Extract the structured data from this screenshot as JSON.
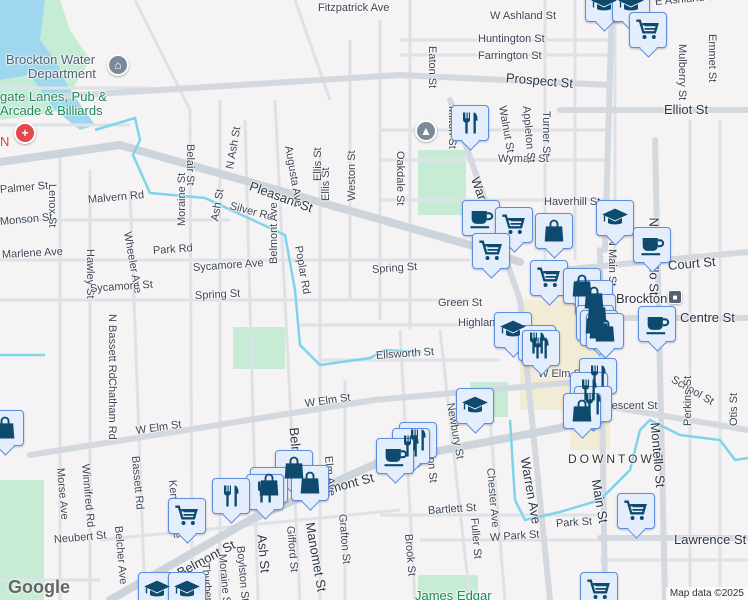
{
  "map": {
    "attribution": "Map data ©2025",
    "logo": "Google",
    "colors": {
      "marker_bg": "#e4edfc",
      "marker_border": "#5c8ee0",
      "marker_icon": "#0d4a6e",
      "water": "#9fd8ee",
      "stream": "#7fd4ea",
      "park": "#c6ecd5",
      "road": "#d3d9df"
    },
    "places": {
      "water_dept": [
        "Brockton Water",
        "Department"
      ],
      "bowling": [
        "gate Lanes, Pub &",
        "Arcade & Billiards"
      ],
      "hospital_fragment": "N",
      "downtown": "DOWNTOWN",
      "station": "Brockton",
      "park": "James Edgar"
    },
    "streets": [
      "Fitzpatrick Ave",
      "W Ashland St",
      "E Ashland St",
      "Huntington St",
      "Farrington St",
      "Prospect St",
      "Elliot St",
      "Wyman St",
      "Haverhill St",
      "Court St",
      "Eaton St",
      "Milton St",
      "Walnut St",
      "Appleton St",
      "Turner St",
      "Mulberry St",
      "Emmet St",
      "Oakdale St",
      "Warren Ave",
      "N Montello St",
      "N Main St",
      "Pleasant St",
      "Lenox St",
      "Palmer St",
      "Malvern Rd",
      "Monson St",
      "Marlene Ave",
      "Hawley St",
      "Wheeler Ave",
      "Park Rd",
      "Sycamore St",
      "Sycamore Ave",
      "Spring St",
      "Belair St",
      "Moraine St",
      "Ash St",
      "N Ash St",
      "Silver Rd",
      "Augusta Ave",
      "Belmont Ave",
      "Poplar Rd",
      "Ellis St",
      "Weston St",
      "Spring St",
      "Green St",
      "Highland St",
      "Ellsworth St",
      "W Elm St",
      "W Elm St",
      "N Bassett Rd",
      "Chatham Rd",
      "Morse Ave",
      "Winnifred Rd",
      "Bassett Rd",
      "Kenelm Ave",
      "Belmont St",
      "Belmont St",
      "Neubert St",
      "Belcher Ave",
      "Thurber Ave",
      "Moraine St",
      "Boylston St",
      "Ash St",
      "Gifford St",
      "Manomet St",
      "Elm Ave",
      "Grafton St",
      "Belmont Ave",
      "Arlington St",
      "Newbury St",
      "Chester Ave",
      "Warren Ave",
      "Brook St",
      "Fuller St",
      "Bartlett St",
      "W Park St",
      "Park St",
      "Main St",
      "Montello St",
      "School St",
      "Perkins St",
      "Otis St",
      "Crescent St",
      "Lawrence St",
      "Centre St",
      "W Elm St",
      "Ellis St"
    ],
    "markers": [
      "school",
      "school",
      "shopping-cart",
      "restaurant",
      "coffee",
      "shopping-cart",
      "shopping-bag",
      "shopping-cart",
      "school",
      "coffee",
      "shopping-cart",
      "shopping-bag",
      "shopping-bag",
      "shopping-bag",
      "school",
      "restaurant",
      "restaurant",
      "shopping-bag",
      "shopping-bag",
      "shopping-bag",
      "coffee",
      "restaurant",
      "restaurant",
      "restaurant",
      "shopping-bag",
      "school",
      "restaurant",
      "restaurant",
      "coffee",
      "shopping-bag",
      "shopping-bag",
      "restaurant",
      "restaurant",
      "shopping-bag",
      "shopping-cart",
      "school",
      "school",
      "shopping-cart",
      "shopping-cart",
      "shopping-bag"
    ]
  }
}
